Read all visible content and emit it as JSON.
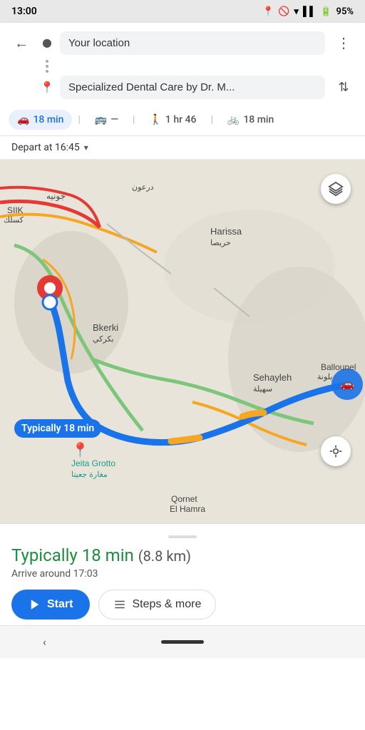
{
  "statusBar": {
    "time": "13:00",
    "battery": "95%"
  },
  "header": {
    "origin": "Your location",
    "destination": "Specialized Dental Care by Dr. M...",
    "backLabel": "←",
    "moreLabel": "⋮",
    "swapLabel": "⇅"
  },
  "transport": {
    "options": [
      {
        "id": "car",
        "icon": "🚗",
        "label": "18 min",
        "active": true
      },
      {
        "id": "transit",
        "icon": "🚌",
        "label": "—",
        "active": false
      },
      {
        "id": "walk",
        "icon": "🚶",
        "label": "1 hr 46",
        "active": false
      },
      {
        "id": "bike",
        "icon": "🚲",
        "label": "18 min",
        "active": false
      }
    ]
  },
  "depart": {
    "label": "Depart at 16:45"
  },
  "map": {
    "badge": "Typically 18 min",
    "places": [
      "Harissa",
      "Sehayleh",
      "Bkerki",
      "Jeita Grotto",
      "Ballounel",
      "Qornet El Hamra",
      "SIIK"
    ]
  },
  "bottomPanel": {
    "routeTime": "Typically 18 min",
    "distance": "(8.8 km)",
    "arrivalText": "Arrive around 17:03",
    "startLabel": "Start",
    "stepsLabel": "Steps & more"
  },
  "bottomNav": {
    "backLabel": "‹"
  }
}
